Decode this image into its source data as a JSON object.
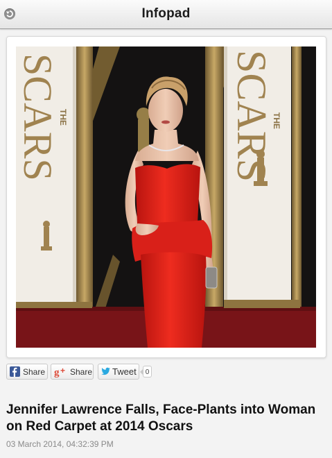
{
  "header": {
    "title": "Infopad",
    "back_icon": "back-arrow-icon"
  },
  "photo": {
    "description_icon": "photo",
    "backdrop_text_left": "SCARS",
    "backdrop_text_left_small": "THE",
    "backdrop_text_right": "SCARS",
    "backdrop_text_right_small": "THE"
  },
  "share": {
    "facebook_label": "Share",
    "google_label": "Share",
    "twitter_label": "Tweet",
    "tweet_count": "0"
  },
  "article": {
    "title": "Jennifer Lawrence Falls, Face-Plants into Woman on Red Carpet at 2014 Oscars",
    "date": "03 March 2014, 04:32:39 PM"
  },
  "colors": {
    "facebook": "#3b5998",
    "google": "#dd4b39",
    "twitter": "#2aa9e0",
    "dress": "#e0241b",
    "carpet": "#7a1418"
  }
}
